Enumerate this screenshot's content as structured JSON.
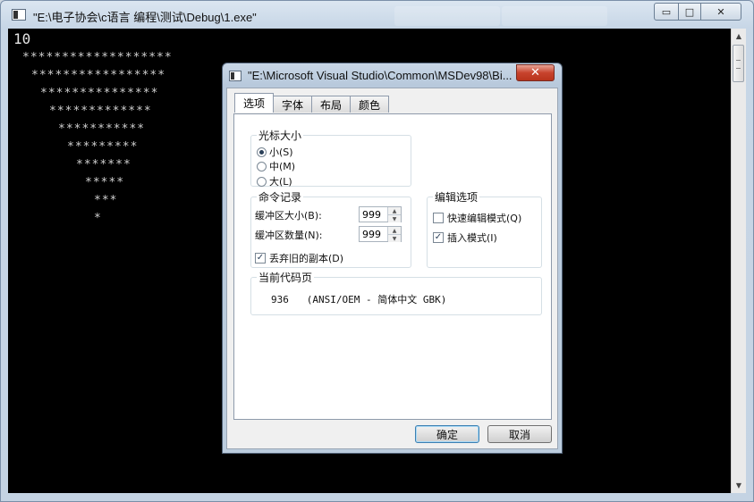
{
  "window": {
    "title": "\"E:\\电子协会\\c语言 编程\\测试\\Debug\\1.exe\"",
    "ghost_buttons": [
      "确定",
      "取消"
    ],
    "caption_buttons": {
      "minimize": "▭",
      "maximize": "□",
      "close": "✕"
    }
  },
  "console": {
    "first_line": "10",
    "pattern": [
      "*******************",
      "*****************",
      "***************",
      "*************",
      "***********",
      "*********",
      "*******",
      "*****",
      "***",
      "*"
    ]
  },
  "scrollbar": {
    "up": "▲",
    "down": "▼"
  },
  "dialog": {
    "title": "\"E:\\Microsoft Visual Studio\\Common\\MSDev98\\Bi...",
    "close": "✕",
    "tabs": [
      "选项",
      "字体",
      "布局",
      "颜色"
    ],
    "cursor_size": {
      "label": "光标大小",
      "options": [
        {
          "label": "小(S)",
          "selected": true
        },
        {
          "label": "中(M)",
          "selected": false
        },
        {
          "label": "大(L)",
          "selected": false
        }
      ]
    },
    "command_history": {
      "label": "命令记录",
      "buffer_size_label": "缓冲区大小(B):",
      "buffer_size_value": "999",
      "buffer_count_label": "缓冲区数量(N):",
      "buffer_count_value": "999",
      "discard_label": "丢弃旧的副本(D)",
      "discard_checked": true
    },
    "edit_options": {
      "label": "编辑选项",
      "quick_edit_label": "快速编辑模式(Q)",
      "quick_edit_checked": false,
      "insert_label": "插入模式(I)",
      "insert_checked": true
    },
    "codepage": {
      "label": "当前代码页",
      "value": "936   (ANSI/OEM - 简体中文 GBK)"
    },
    "ok_label": "确定",
    "cancel_label": "取消",
    "check_glyph": "✓"
  }
}
